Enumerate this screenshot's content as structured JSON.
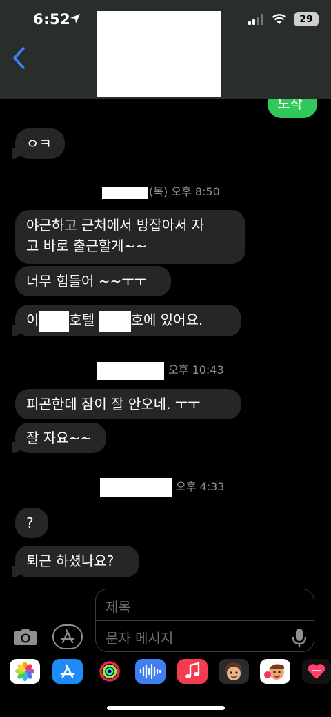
{
  "status": {
    "time": "6:52",
    "battery": "29"
  },
  "messages": {
    "outgoing_partial": "도착",
    "m1": "ㅇㅋ",
    "ts1": {
      "day": "(목)",
      "time": "오후 8:50"
    },
    "m2_line1": "야근하고 근처에서 방잡아서 자",
    "m2_line2": "고 바로 출근할게~~",
    "m3": "너무 힘들어 ~~ㅜㅜ",
    "m4": {
      "a": "이",
      "b": "호텔",
      "c": "호에 있어요."
    },
    "ts2": "오후 10:43",
    "m5": "피곤한데 잠이 잘 안오네. ㅜㅜ",
    "m6": "잘 자요~~",
    "ts3": "오후 4:33",
    "m7": "?",
    "m8": "퇴근 하셨나요?"
  },
  "compose": {
    "subject_placeholder": "제목",
    "message_placeholder": "문자 메시지"
  },
  "drawer": {
    "apps": [
      "photos-icon",
      "app-store-icon",
      "fitness-icon",
      "audio-icon",
      "music-icon",
      "memoji-icon",
      "memoji-stickers-icon",
      "digital-touch-icon"
    ]
  },
  "colors": {
    "incoming_bubble": "#262628",
    "outgoing_bubble": "#30c85a",
    "header_bg": "#2a2e2b",
    "accent": "#3a82f7"
  }
}
